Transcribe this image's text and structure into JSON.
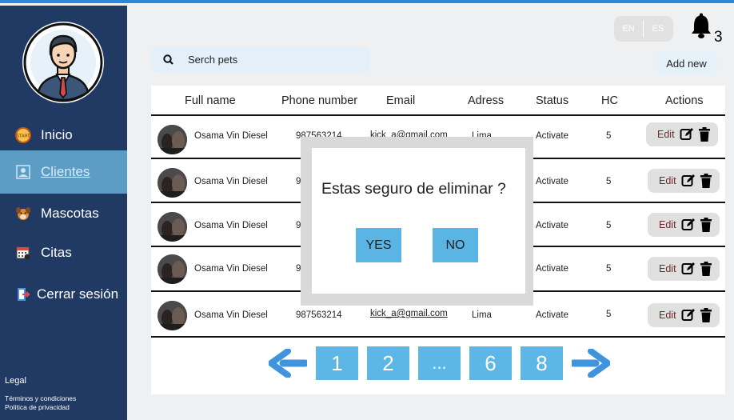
{
  "sidebar": {
    "items": [
      {
        "label": "Inicio",
        "icon": "start-icon"
      },
      {
        "label": "Clientes",
        "icon": "users-icon"
      },
      {
        "label": "Mascotas",
        "icon": "dog-icon"
      },
      {
        "label": "Citas",
        "icon": "calendar-icon"
      },
      {
        "label": "Cerrar sesión",
        "icon": "logout-icon"
      }
    ],
    "legal": "Legal",
    "terms": "Términos y condiciones",
    "privacy": "Política de privacidad"
  },
  "header": {
    "lang_en": "EN",
    "lang_es": "ES",
    "notification_count": "3"
  },
  "search": {
    "placeholder": "Serch pets"
  },
  "add_new": "Add new",
  "table": {
    "columns": [
      "Full name",
      "Phone number",
      "Email",
      "Adress",
      "Status",
      "HC",
      "Actions"
    ],
    "rows": [
      {
        "name": "Osama Vin Diesel",
        "phone": "987563214",
        "email": "kick_a@gmail.com",
        "address": "Lima",
        "status": "Activate",
        "hc": "5",
        "edit": "Edit"
      },
      {
        "name": "Osama Vin Diesel",
        "phone": "9",
        "email": "",
        "address": "",
        "status": "Activate",
        "hc": "5",
        "edit": "Edit"
      },
      {
        "name": "Osama Vin Diesel",
        "phone": "9",
        "email": "",
        "address": "",
        "status": "Activate",
        "hc": "5",
        "edit": "Edit"
      },
      {
        "name": "Osama Vin Diesel",
        "phone": "9",
        "email": "",
        "address": "",
        "status": "Activate",
        "hc": "5",
        "edit": "Edit"
      },
      {
        "name": "Osama Vin Diesel",
        "phone": "987563214",
        "email": "kick_a@gmail.com",
        "address": "Lima",
        "status": "Activate",
        "hc": "5",
        "edit": "Edit"
      }
    ]
  },
  "pagination": {
    "pages": [
      "1",
      "2",
      "...",
      "6",
      "8"
    ]
  },
  "modal": {
    "message": "Estas seguro de eliminar ?",
    "yes": "YES",
    "no": "NO"
  },
  "colors": {
    "sidebar": "#213a63",
    "active_item": "#5d9dc5",
    "accent": "#5cb7e6",
    "arrow": "#3f95dd"
  }
}
